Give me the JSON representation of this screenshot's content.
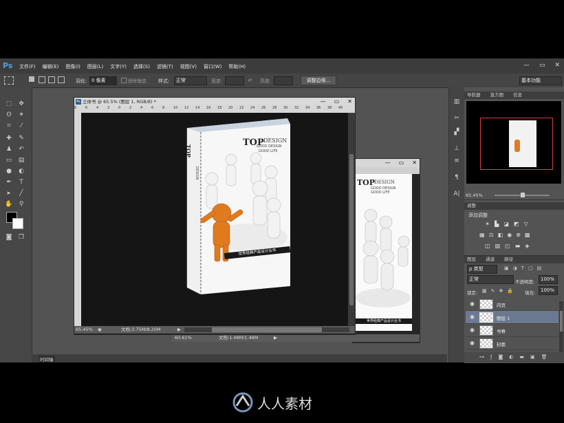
{
  "app": {
    "logo": "Ps",
    "menu": [
      "文件(F)",
      "编辑(E)",
      "图像(I)",
      "图层(L)",
      "文字(Y)",
      "选择(S)",
      "滤镜(T)",
      "视图(V)",
      "窗口(W)",
      "帮助(H)"
    ],
    "window_buttons": [
      "—",
      "▭",
      "✕"
    ]
  },
  "options": {
    "feather_label": "羽化:",
    "feather_value": "0 像素",
    "antialias_label": "消除锯齿",
    "style_label": "样式:",
    "style_value": "正常",
    "width_label": "宽度:",
    "height_label": "高度:",
    "refine_edge": "调整边缘...",
    "workspace": "基本功能"
  },
  "doc_main": {
    "title": "立体书 @ 65.5% (图层 1, RGB/8) *",
    "zoom": "65.45%",
    "doc_info": "文档:3.75M/8.20M",
    "ruler_labels": [
      "8",
      "6",
      "4",
      "2",
      "0",
      "2",
      "4",
      "6",
      "8",
      "10",
      "12",
      "14",
      "16",
      "18",
      "20",
      "22",
      "24",
      "26",
      "28",
      "30",
      "32",
      "34",
      "36",
      "38",
      "40"
    ],
    "book": {
      "top": "TOP",
      "design": "DESIGN",
      "tag1": "GOOD DESIGN",
      "tag2": "GOOD   LIFE",
      "spine_top": "TOP",
      "spine_design": "DESIGN",
      "banner": "世界经典产品设计丛书"
    }
  },
  "doc_second": {
    "zoom": "60.61%",
    "doc_info": "文档:1.48M/1.48M",
    "book": {
      "top": "TOP",
      "design": "DESIGN",
      "tag1": "GOOD DESIGN",
      "tag2": "GOOD   LIFE",
      "banner": "世界经典产品设计丛书"
    }
  },
  "navigator": {
    "tabs": [
      "导航器",
      "直方图",
      "信息"
    ],
    "zoom": "65.45%"
  },
  "adjustments": {
    "tab": "调整",
    "title": "添加调整"
  },
  "layers": {
    "tabs": [
      "图层",
      "通道",
      "路径"
    ],
    "kind": "ρ 类型",
    "blend_mode": "正常",
    "opacity_label": "不透明度:",
    "opacity_value": "100%",
    "lock_label": "锁定:",
    "fill_label": "填充:",
    "fill_value": "100%",
    "items": [
      {
        "name": "内页",
        "selected": false
      },
      {
        "name": "图层 1",
        "selected": true
      },
      {
        "name": "书脊",
        "selected": false
      },
      {
        "name": "封面",
        "selected": false
      }
    ]
  },
  "timeline": {
    "label": "时间轴"
  },
  "watermark": {
    "text": "人人素材"
  },
  "colors": {
    "accent": "#4aa3df",
    "figure_orange": "#e07a1f",
    "selection_red": "#d84040"
  }
}
